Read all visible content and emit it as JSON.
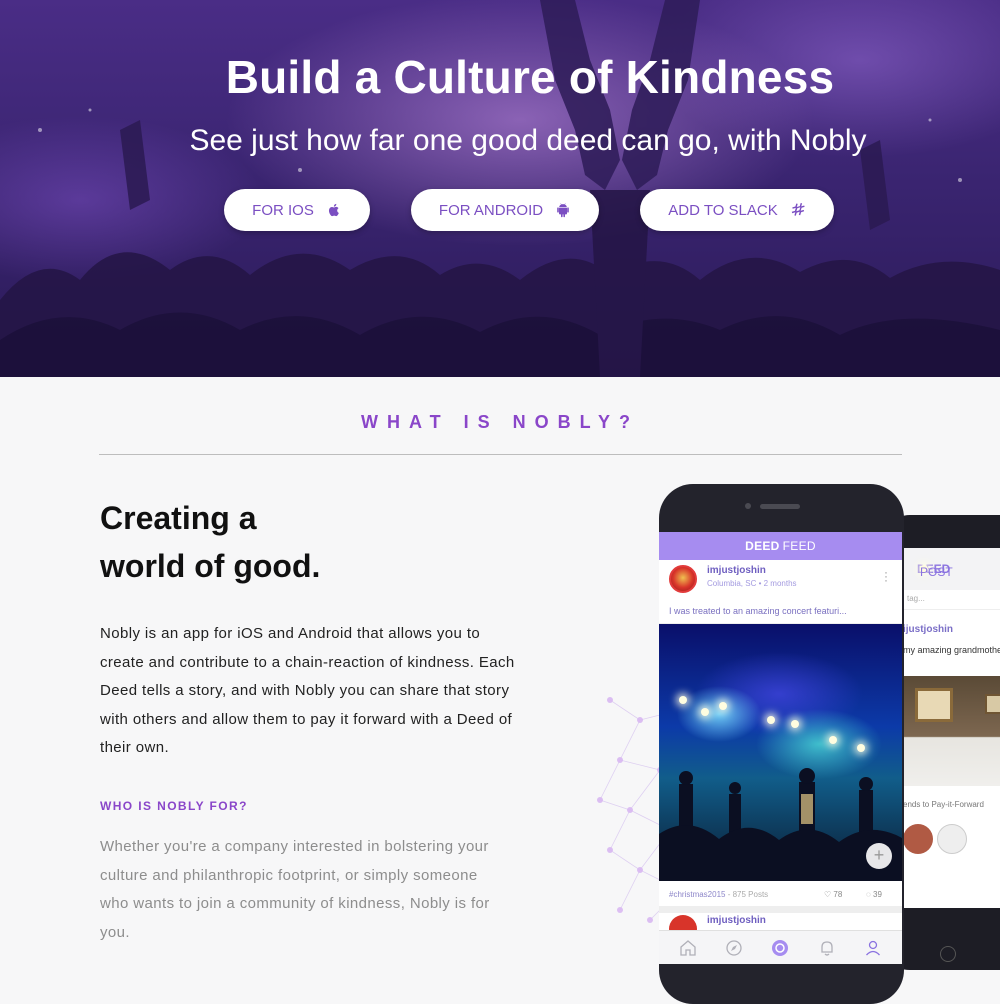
{
  "hero": {
    "title": "Build a Culture of Kindness",
    "subtitle": "See just how far one good deed can go, with Nobly",
    "buttons": {
      "ios": "FOR IOS",
      "android": "FOR ANDROID",
      "slack": "ADD TO SLACK"
    }
  },
  "section": {
    "heading": "WHAT IS NOBLY?",
    "headline_line1": "Creating a",
    "headline_line2": "world of good.",
    "description": "Nobly is an app for iOS and Android that allows you to create and contribute to a chain-reaction of kindness. Each Deed tells a story, and with Nobly you can share that story with others and allow them to pay it forward with a Deed of their own.",
    "who_heading": "WHO IS NOBLY FOR?",
    "who_text": "Whether you're a company interested in bolstering your culture and philanthropic footprint, or simply someone who wants to join a community of kindness, Nobly is for you."
  },
  "phone_front": {
    "header_bold": "DEED",
    "header_light": "FEED",
    "username": "imjustjoshin",
    "location": "Columbia, SC",
    "time": "• 2 months",
    "caption": "I was treated to an amazing concert featuri...",
    "hashtag": "#christmas2015",
    "posts": "- 875 Posts",
    "likes": "78",
    "comments": "39",
    "next_username": "imjustjoshin"
  },
  "phone_back": {
    "header_bold": "DEED",
    "header_light": "POST",
    "tag_placeholder": "tag...",
    "username": "ijustjoshin",
    "caption": "my amazing grandmother",
    "pay_forward": "ends to Pay-it-Forward"
  },
  "colors": {
    "accent": "#8a46c9",
    "button_text": "#7b4fc2",
    "feed_header": "#a68cf0"
  }
}
